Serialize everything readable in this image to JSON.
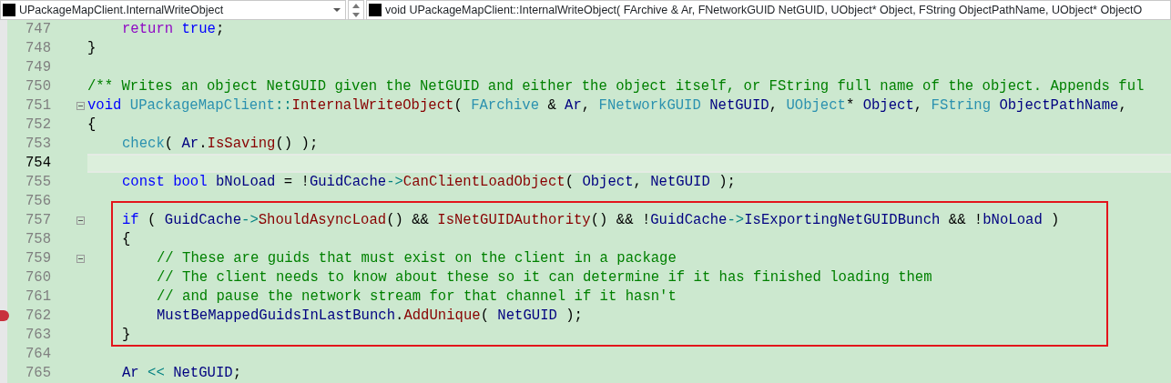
{
  "toolbar": {
    "scope_dropdown": "UPackageMapClient.InternalWriteObject",
    "member_dropdown": "void UPackageMapClient::InternalWriteObject( FArchive & Ar, FNetworkGUID NetGUID, UObject* Object, FString ObjectPathName, UObject* ObjectO"
  },
  "lines_before": [
    {
      "number": "747",
      "indented": true,
      "tokens": [
        {
          "kind": "c",
          "text": "return "
        },
        {
          "kind": "k",
          "text": "true"
        },
        {
          "kind": "p",
          "text": ";"
        }
      ]
    },
    {
      "number": "748",
      "tokens": [
        {
          "kind": "p",
          "text": "}"
        }
      ]
    },
    {
      "number": "749"
    },
    {
      "number": "750",
      "tokens": [
        {
          "kind": "m",
          "text": "/** Writes an object NetGUID given the NetGUID and either the object itself, or FString full name of the object. Appends ful"
        }
      ]
    },
    {
      "number": "751",
      "foldable": true,
      "tokens": [
        {
          "kind": "k",
          "text": "void "
        },
        {
          "kind": "t",
          "text": "UPackageMapClient"
        },
        {
          "kind": "o",
          "text": "::"
        },
        {
          "kind": "f",
          "text": "InternalWriteObject"
        },
        {
          "kind": "p",
          "text": "( "
        },
        {
          "kind": "t",
          "text": "FArchive "
        },
        {
          "kind": "p",
          "text": "& "
        },
        {
          "kind": "v",
          "text": "Ar"
        },
        {
          "kind": "p",
          "text": ", "
        },
        {
          "kind": "t",
          "text": "FNetworkGUID "
        },
        {
          "kind": "v",
          "text": "NetGUID"
        },
        {
          "kind": "p",
          "text": ", "
        },
        {
          "kind": "t",
          "text": "UObject"
        },
        {
          "kind": "p",
          "text": "* "
        },
        {
          "kind": "v",
          "text": "Object"
        },
        {
          "kind": "p",
          "text": ", "
        },
        {
          "kind": "t",
          "text": "FString "
        },
        {
          "kind": "v",
          "text": "ObjectPathName"
        },
        {
          "kind": "p",
          "text": ","
        }
      ]
    },
    {
      "number": "752",
      "tokens": [
        {
          "kind": "p",
          "text": "{"
        }
      ]
    },
    {
      "number": "753",
      "indented": true,
      "tokens": [
        {
          "kind": "t",
          "text": "check"
        },
        {
          "kind": "p",
          "text": "( "
        },
        {
          "kind": "v",
          "text": "Ar"
        },
        {
          "kind": "p",
          "text": "."
        },
        {
          "kind": "f",
          "text": "IsSaving"
        },
        {
          "kind": "p",
          "text": "() );"
        }
      ]
    },
    {
      "number": "754",
      "current": true
    },
    {
      "number": "755",
      "indented": true,
      "tokens": [
        {
          "kind": "k",
          "text": "const "
        },
        {
          "kind": "k",
          "text": "bool "
        },
        {
          "kind": "v",
          "text": "bNoLoad "
        },
        {
          "kind": "p",
          "text": "= !"
        },
        {
          "kind": "v",
          "text": "GuidCache"
        },
        {
          "kind": "o",
          "text": "->"
        },
        {
          "kind": "f",
          "text": "CanClientLoadObject"
        },
        {
          "kind": "p",
          "text": "( "
        },
        {
          "kind": "v",
          "text": "Object"
        },
        {
          "kind": "p",
          "text": ", "
        },
        {
          "kind": "v",
          "text": "NetGUID "
        },
        {
          "kind": "p",
          "text": ");"
        }
      ]
    },
    {
      "number": "756"
    }
  ],
  "highlight_box": {
    "lines": [
      {
        "number": "757",
        "indented": true,
        "foldable": true,
        "tokens": [
          {
            "kind": "k",
            "text": "if "
          },
          {
            "kind": "p",
            "text": "( "
          },
          {
            "kind": "v",
            "text": "GuidCache"
          },
          {
            "kind": "o",
            "text": "->"
          },
          {
            "kind": "f",
            "text": "ShouldAsyncLoad"
          },
          {
            "kind": "p",
            "text": "() && "
          },
          {
            "kind": "f",
            "text": "IsNetGUIDAuthority"
          },
          {
            "kind": "p",
            "text": "() && !"
          },
          {
            "kind": "v",
            "text": "GuidCache"
          },
          {
            "kind": "o",
            "text": "->"
          },
          {
            "kind": "v",
            "text": "IsExportingNetGUIDBunch "
          },
          {
            "kind": "p",
            "text": "&& !"
          },
          {
            "kind": "v",
            "text": "bNoLoad "
          },
          {
            "kind": "p",
            "text": ")"
          }
        ]
      },
      {
        "number": "758",
        "indented": true,
        "tokens": [
          {
            "kind": "p",
            "text": "{"
          }
        ]
      },
      {
        "number": "759",
        "indented": true,
        "nested": true,
        "foldable": true,
        "tokens": [
          {
            "kind": "m",
            "text": "// These are guids that must exist on the client in a package"
          }
        ]
      },
      {
        "number": "760",
        "indented": true,
        "nested": true,
        "tokens": [
          {
            "kind": "m",
            "text": "// The client needs to know about these so it can determine if it has finished loading them"
          }
        ]
      },
      {
        "number": "761",
        "indented": true,
        "nested": true,
        "tokens": [
          {
            "kind": "m",
            "text": "// and pause the network stream for that channel if it hasn't"
          }
        ]
      },
      {
        "number": "762",
        "indented": true,
        "nested": true,
        "breakpoint": true,
        "tokens": [
          {
            "kind": "v",
            "text": "MustBeMappedGuidsInLastBunch"
          },
          {
            "kind": "p",
            "text": "."
          },
          {
            "kind": "f",
            "text": "AddUnique"
          },
          {
            "kind": "p",
            "text": "( "
          },
          {
            "kind": "v",
            "text": "NetGUID "
          },
          {
            "kind": "p",
            "text": ");"
          }
        ]
      },
      {
        "number": "763",
        "indented": true,
        "tokens": [
          {
            "kind": "p",
            "text": "}"
          }
        ]
      }
    ]
  },
  "lines_after": [
    {
      "number": "764"
    },
    {
      "number": "765",
      "indented": true,
      "tokens": [
        {
          "kind": "v",
          "text": "Ar "
        },
        {
          "kind": "o",
          "text": "<< "
        },
        {
          "kind": "v",
          "text": "NetGUID"
        },
        {
          "kind": "p",
          "text": ";"
        }
      ]
    }
  ]
}
